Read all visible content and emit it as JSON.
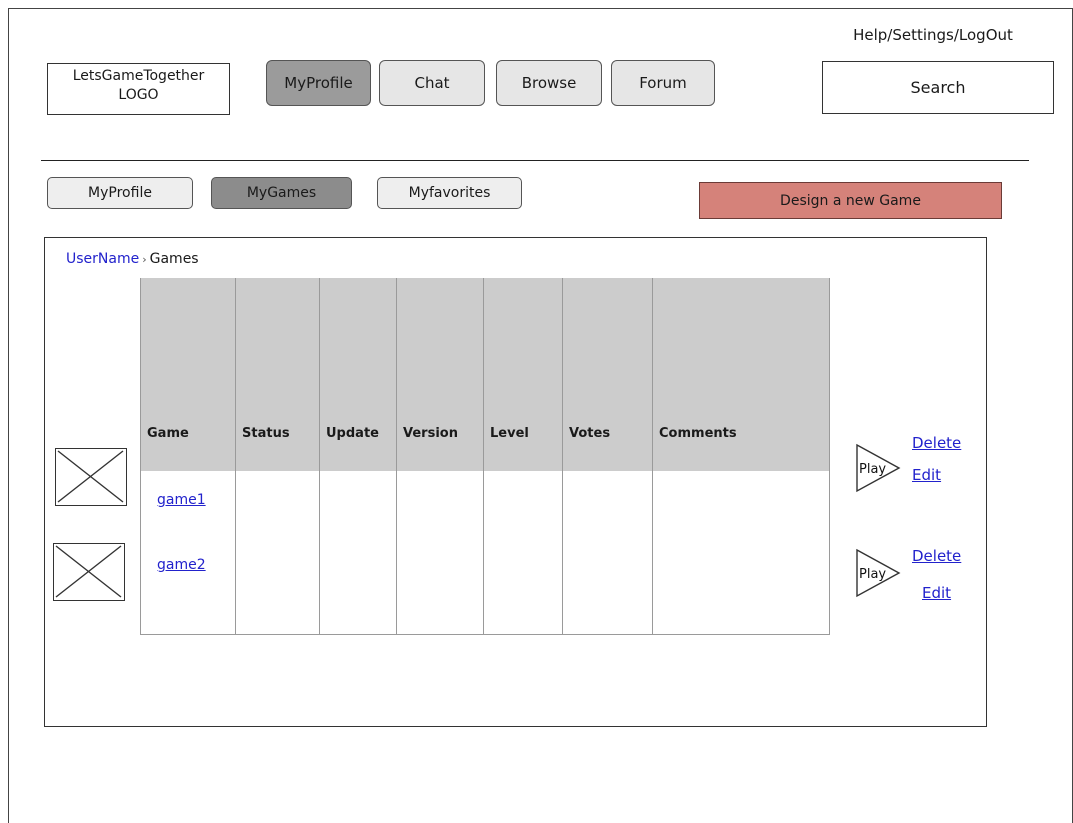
{
  "header": {
    "logo_text_line1": "LetsGameTogether",
    "logo_text_line2": "LOGO",
    "top_links": "Help/Settings/LogOut",
    "search_label": "Search"
  },
  "top_nav": {
    "items": [
      {
        "label": "MyProfile",
        "active": true
      },
      {
        "label": "Chat",
        "active": false
      },
      {
        "label": "Browse",
        "active": false
      },
      {
        "label": "Forum",
        "active": false
      }
    ]
  },
  "sub_nav": {
    "items": [
      {
        "label": "MyProfile",
        "active": false
      },
      {
        "label": "MyGames",
        "active": true
      },
      {
        "label": "Myfavorites",
        "active": false
      }
    ],
    "design_button": "Design a new Game",
    "design_button_color": "#d5827a"
  },
  "breadcrumb": {
    "user": "UserName",
    "separator": "›",
    "current": "Games"
  },
  "games_table": {
    "columns": [
      "Game",
      "Status",
      "Update",
      "Version",
      "Level",
      "Votes",
      "Comments"
    ],
    "rows": [
      {
        "name": "game1",
        "play_label": "Play",
        "delete_label": "Delete",
        "edit_label": "Edit"
      },
      {
        "name": "game2",
        "play_label": "Play",
        "delete_label": "Delete",
        "edit_label": "Edit"
      }
    ]
  },
  "colors": {
    "link": "#2222cc",
    "active_tab": "#9b9b9b",
    "table_header": "#cccccc"
  }
}
